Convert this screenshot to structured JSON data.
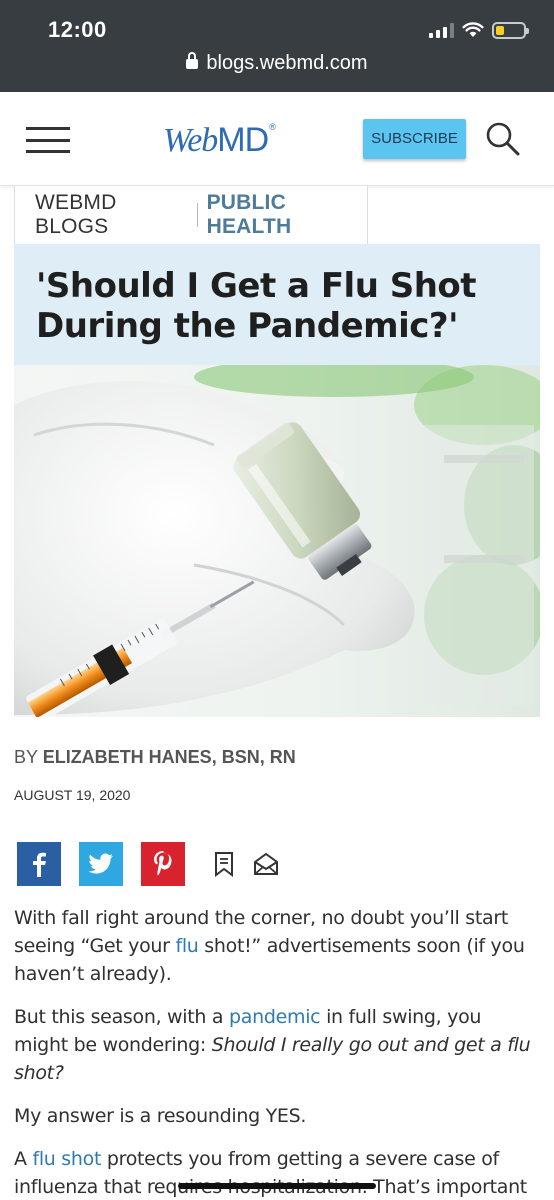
{
  "status_bar": {
    "time": "12:00",
    "signal_bars": 3,
    "battery_fill": 0.15,
    "battery_color": "#f7cf22"
  },
  "browser": {
    "url": "blogs.webmd.com"
  },
  "header": {
    "logo_web": "Web",
    "logo_md": "MD",
    "subscribe_label": "SUBSCRIBE",
    "icons": [
      "menu-icon",
      "search-icon"
    ]
  },
  "breadcrumb": {
    "section": "WEBMD BLOGS",
    "topic": "PUBLIC HEALTH"
  },
  "article": {
    "title": "'Should I Get a Flu Shot During the Pandemic?'",
    "byline_prefix": "BY ",
    "author": "ELIZABETH HANES, BSN, RN",
    "date": "AUGUST 19, 2020",
    "share_icons": [
      "facebook-icon",
      "twitter-icon",
      "pinterest-icon",
      "bookmark-icon",
      "email-icon"
    ],
    "p1_a": "With fall right around the corner, no doubt you’ll start seeing “Get your ",
    "p1_link": "flu",
    "p1_b": " shot!” advertisements soon (if you haven’t already).",
    "p2_a": "But this season, with a ",
    "p2_link": "pandemic",
    "p2_b": " in full swing, you might be wondering: ",
    "p2_em": "Should I really go out and get a flu shot?",
    "p3": "My answer is a resounding YES.",
    "p4_a": "A ",
    "p4_link": "flu shot",
    "p4_b": " protects you from getting a severe case of influenza that requires hospitalization. That’s important"
  },
  "colors": {
    "status_bg": "#383d41",
    "brand_blue": "#2d6bb5",
    "subscribe_bg": "#5bc4ef",
    "topic_text": "#4d7b99",
    "title_bg": "#dfeef6",
    "link": "#2f7ab0",
    "facebook": "#2a5fa3",
    "twitter": "#2fa8e1",
    "pinterest": "#d8222d"
  }
}
